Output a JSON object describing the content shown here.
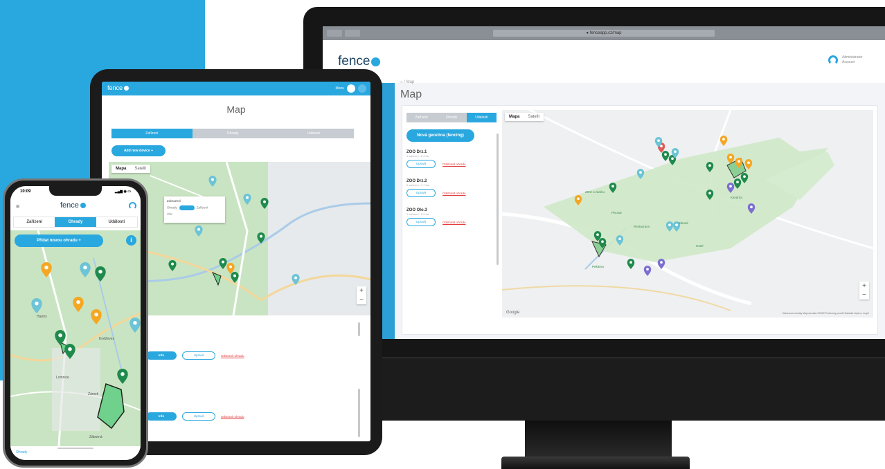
{
  "desktop": {
    "browser_url": "● fenceapp.cz/map",
    "logo_text": "fence",
    "user_name": "Administrator Account",
    "breadcrumb": "⌂ / Map",
    "page_title": "Map",
    "tabs": [
      "Zařízení",
      "Ohrady",
      "Události"
    ],
    "new_button": "Nová geozóna (fencing)",
    "items": [
      {
        "name": "ZOO Drz.1",
        "sub": "1 zařízení / 2.3 ha",
        "edit": "Upravit",
        "delete": "Odstranit ohradu"
      },
      {
        "name": "ZOO Drz.2",
        "sub": "2 zařízení / 1.7 ha",
        "edit": "Upravit",
        "delete": "Odstranit ohradu"
      },
      {
        "name": "ZOO Olo.3",
        "sub": "1 zařízení / 0.9 ha",
        "edit": "Upravit",
        "delete": "Odstranit ohradu"
      }
    ],
    "map_types": [
      "Mapa",
      "Satelit"
    ],
    "zoom_in": "+",
    "zoom_out": "−",
    "google": "Google",
    "attribution": "Klávesové zkratky   Mapová data ©2022   Podmínky použití   Nahlásit chybu v mapě",
    "place_labels": [
      "ZOO u zámku",
      "Pivovar",
      "Restaurace",
      "Zámek",
      "Hotel",
      "Pekárna",
      "Kavárna"
    ]
  },
  "tablet": {
    "logo_text": "fence",
    "menu_label": "Menu",
    "page_title": "Map",
    "tabs": [
      "Zařízení",
      "Ohrady",
      "Události"
    ],
    "add_button": "Add new device  +",
    "map_types": [
      "Mapa",
      "Satelit"
    ],
    "popup_title": "Zobrazení",
    "popup_labels": [
      "Ohrady",
      "Zařízení"
    ],
    "popup_value": "Vše",
    "zoom_in": "+",
    "zoom_out": "−",
    "rows": [
      {
        "primary": "Info",
        "secondary": "Upravit",
        "delete": "Odstranit ohradu"
      },
      {
        "primary": "Info",
        "secondary": "Upravit",
        "delete": "Odstranit ohradu"
      }
    ]
  },
  "phone": {
    "time": "10:09",
    "status_icons": "▂▄▆ ◉ ▭",
    "logo_text": "fence",
    "menu_icon": "≡",
    "tabs": [
      "Zařízení",
      "Ohrady",
      "Události"
    ],
    "add_button": "Přidat novou ohradu  +",
    "info_icon": "i",
    "bottom_link": "Ohrady",
    "town_labels": [
      "Hamry",
      "Kněževes",
      "Lomnice",
      "Zámek",
      "Záborná"
    ]
  },
  "colors": {
    "brand_blue": "#29a7df",
    "pin_green": "#1f8a4c",
    "pin_orange": "#f5a623",
    "pin_teal": "#6cc4d6",
    "fence_green": "#6fd18b",
    "map_bg": "#e8ecee",
    "map_green": "#cfe8c8"
  }
}
